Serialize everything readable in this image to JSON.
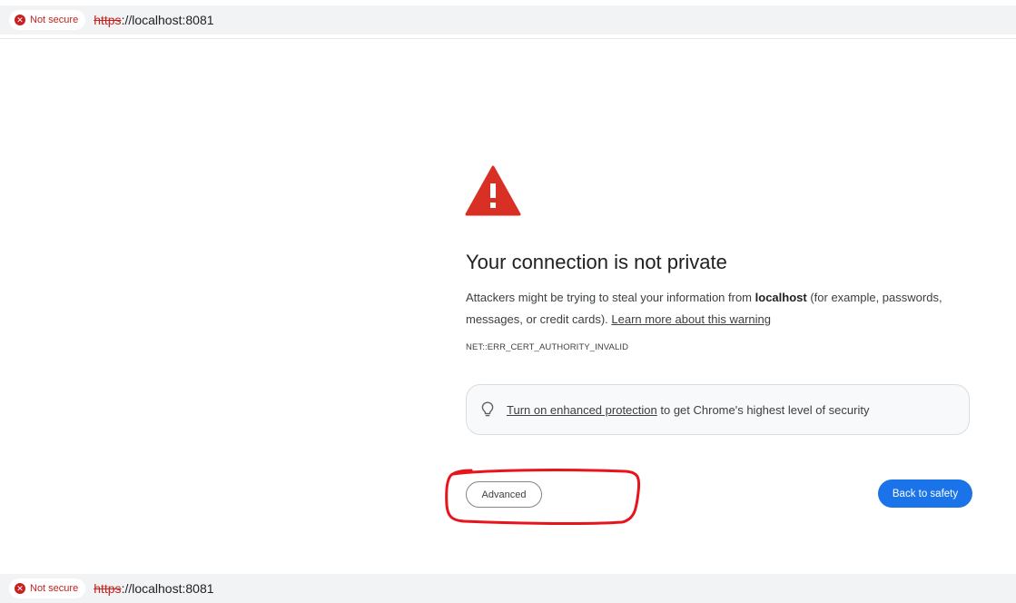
{
  "address_bar": {
    "security_label": "Not secure",
    "url_scheme": "https",
    "url_rest": "://localhost:8081"
  },
  "footer_bar": {
    "security_label": "Not secure",
    "url_scheme": "https",
    "url_rest": "://localhost:8081"
  },
  "interstitial": {
    "icon": "warning-triangle-icon",
    "title": "Your connection is not private",
    "body_prefix": "Attackers might be trying to steal your information from ",
    "host": "localhost",
    "body_suffix": " (for example, passwords, messages, or credit cards). ",
    "learn_more": "Learn more about this warning",
    "error_code": "NET::ERR_CERT_AUTHORITY_INVALID",
    "enhanced_link": "Turn on enhanced protection",
    "enhanced_suffix": " to get Chrome's highest level of security",
    "advanced_label": "Advanced",
    "back_label": "Back to safety"
  },
  "colors": {
    "warning_red": "#d93025",
    "not_secure_red": "#c5221f",
    "primary_blue": "#1a73e8",
    "annotation_red": "#e8141b"
  }
}
